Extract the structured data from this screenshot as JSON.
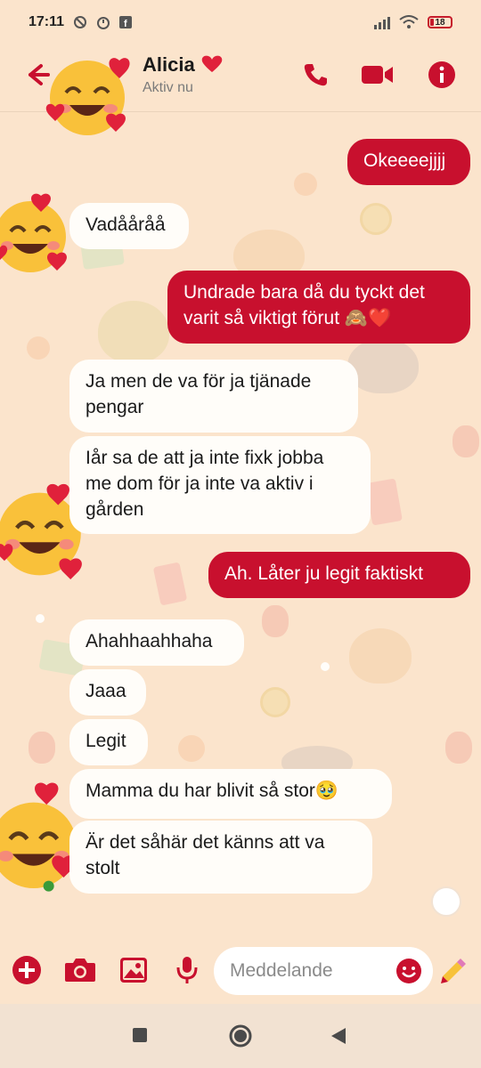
{
  "status_bar": {
    "time": "17:11",
    "battery": "18"
  },
  "header": {
    "contact_name": "Alicia",
    "contact_status": "Aktiv nu",
    "icons": [
      "back-arrow-icon",
      "phone-icon",
      "video-call-icon",
      "info-icon"
    ],
    "accent_color": "#c8102e"
  },
  "messages": [
    {
      "direction": "out",
      "text": "Okeeeejjjj"
    },
    {
      "direction": "in",
      "text": "Vadååråå"
    },
    {
      "direction": "out",
      "text": "Undrade bara då du tyckt det varit så viktigt förut 🙈❤️"
    },
    {
      "direction": "in",
      "text": "Ja men de va för ja tjänade pengar"
    },
    {
      "direction": "in",
      "text": "Iår sa de att ja inte fixk jobba me dom för ja inte va aktiv i gården"
    },
    {
      "direction": "out",
      "text": "Ah. Låter ju legit faktiskt"
    },
    {
      "direction": "in",
      "text": "Ahahhaahhaha"
    },
    {
      "direction": "in",
      "text": "Jaaa"
    },
    {
      "direction": "in",
      "text": "Legit"
    },
    {
      "direction": "in",
      "text": "Mamma du har blivit så stor🥹"
    },
    {
      "direction": "in",
      "text": "Är det såhär det känns att va stolt"
    }
  ],
  "composer": {
    "placeholder": "Meddelande",
    "icons": [
      "add-icon",
      "camera-icon",
      "gallery-icon",
      "microphone-icon",
      "emoji-icon",
      "sticker-icon"
    ]
  },
  "nav_bar": {
    "icons": [
      "recents-icon",
      "home-icon",
      "back-icon"
    ]
  }
}
